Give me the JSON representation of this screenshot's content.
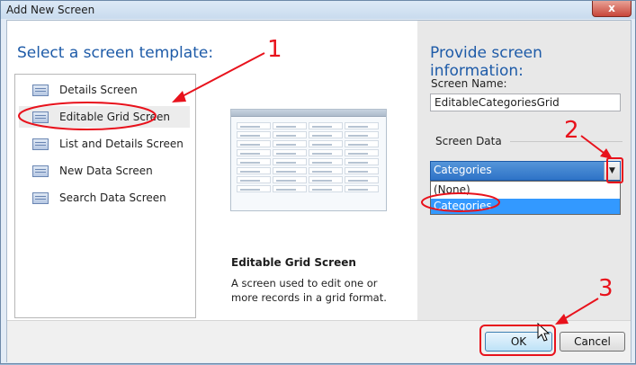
{
  "window": {
    "title": "Add New Screen",
    "close_glyph": "x"
  },
  "left": {
    "heading": "Select a screen template:",
    "templates": [
      {
        "label": "Details Screen",
        "icon": "details-screen-icon"
      },
      {
        "label": "Editable Grid Screen",
        "icon": "grid-screen-icon",
        "selected": true
      },
      {
        "label": "List and Details Screen",
        "icon": "list-details-screen-icon"
      },
      {
        "label": "New Data Screen",
        "icon": "new-data-screen-icon"
      },
      {
        "label": "Search Data Screen",
        "icon": "search-data-screen-icon"
      }
    ],
    "preview_title": "Editable Grid Screen",
    "preview_description": "A screen used to edit one or more records in a grid format."
  },
  "right": {
    "heading": "Provide screen information:",
    "screen_name_label": "Screen Name:",
    "screen_name_value": "EditableCategoriesGrid",
    "screen_data_label": "Screen Data",
    "screen_data_value": "Categories",
    "screen_data_options": [
      {
        "label": "(None)",
        "selected": false
      },
      {
        "label": "Categories",
        "selected": true
      }
    ]
  },
  "footer": {
    "ok_label": "OK",
    "cancel_label": "Cancel"
  },
  "annotations": {
    "marker_1": "1",
    "marker_2": "2",
    "marker_3": "3",
    "color": "#e8121c"
  },
  "colors": {
    "heading": "#1e5ba8",
    "selection": "#3399ff",
    "combo_selected": "#2e73c7"
  }
}
